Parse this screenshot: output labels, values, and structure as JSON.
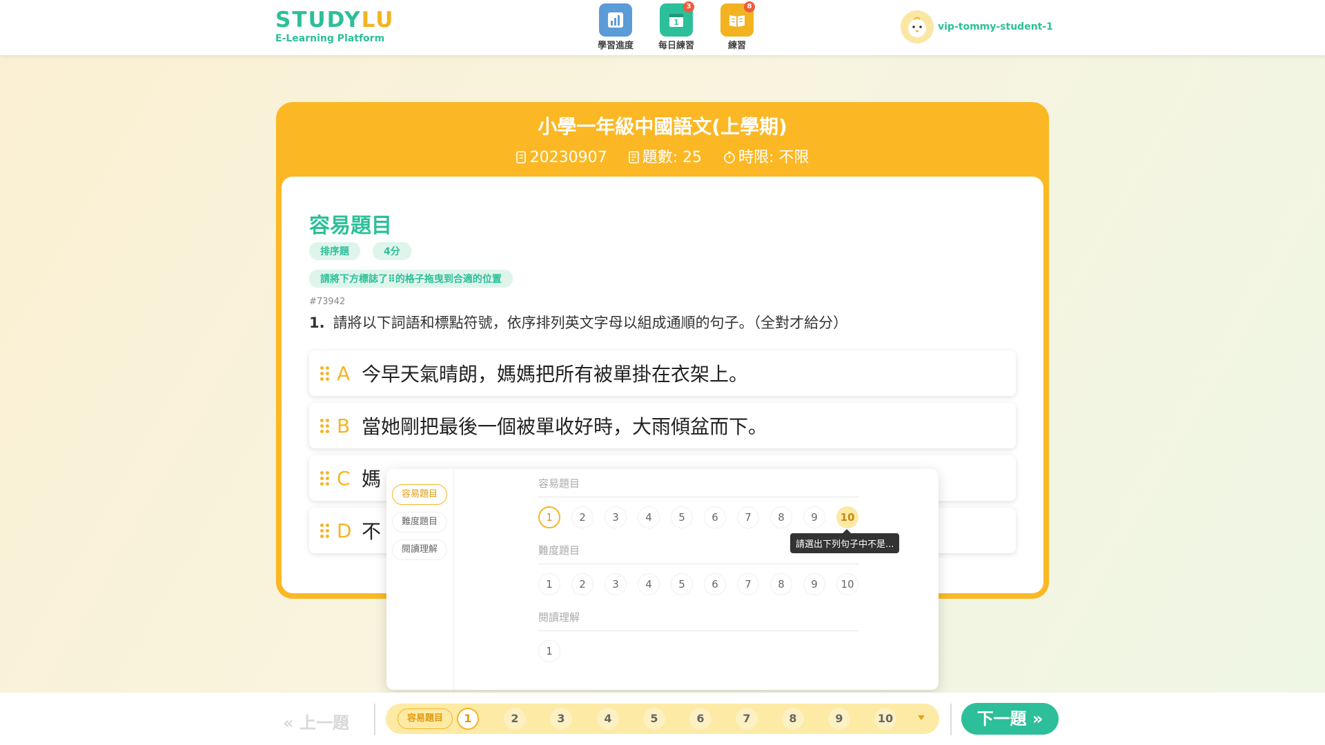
{
  "header": {
    "brand_part1": "STUDY",
    "brand_part2": "LU",
    "subtitle": "E-Learning Platform",
    "nav": [
      {
        "label": "學習進度",
        "icon": "progress-chart-icon",
        "badge": ""
      },
      {
        "label": "每日練習",
        "icon": "calendar-icon",
        "badge": "3"
      },
      {
        "label": "練習",
        "icon": "book-icon",
        "badge": "8"
      }
    ],
    "username": "vip-tommy-student-1"
  },
  "exam": {
    "title": "小學一年級中國語文(上學期)",
    "code": "20230907",
    "question_count": "題數: 25",
    "time_limit": "時限: 不限"
  },
  "section": {
    "title": "容易題目",
    "tags": [
      "排序題",
      "4分"
    ],
    "hint": "請將下方標誌了⠿的格子拖曳到合適的位置",
    "question_id": "#73942",
    "question_number": "1.",
    "question_text": "請將以下詞語和標點符號，依序排列英文字母以組成通順的句子。（全對才給分）",
    "options": [
      {
        "letter": "A",
        "text": "今早天氣晴朗，媽媽把所有被單掛在衣架上。"
      },
      {
        "letter": "B",
        "text": "當她剛把最後一個被單收好時，大雨傾盆而下。"
      },
      {
        "letter": "C",
        "text": "媽"
      },
      {
        "letter": "D",
        "text": "不"
      }
    ]
  },
  "popup": {
    "tabs": [
      "容易題目",
      "難度題目",
      "閱讀理解"
    ],
    "groups": [
      {
        "title": "容易題目",
        "numbers": [
          "1",
          "2",
          "3",
          "4",
          "5",
          "6",
          "7",
          "8",
          "9",
          "10"
        ]
      },
      {
        "title": "難度題目",
        "numbers": [
          "1",
          "2",
          "3",
          "4",
          "5",
          "6",
          "7",
          "8",
          "9",
          "10"
        ]
      },
      {
        "title": "閱讀理解",
        "numbers": [
          "1"
        ]
      }
    ],
    "tooltip": "請選出下列句子中不是..."
  },
  "footer": {
    "prev_label": "上一題",
    "section_pill": "容易題目",
    "numbers": [
      "1",
      "2",
      "3",
      "4",
      "5",
      "6",
      "7",
      "8",
      "9",
      "10"
    ],
    "next_label": "下一題"
  },
  "colors": {
    "brand_green": "#2cbf99",
    "brand_yellow": "#fbb824",
    "highlight": "#fde9a6"
  }
}
